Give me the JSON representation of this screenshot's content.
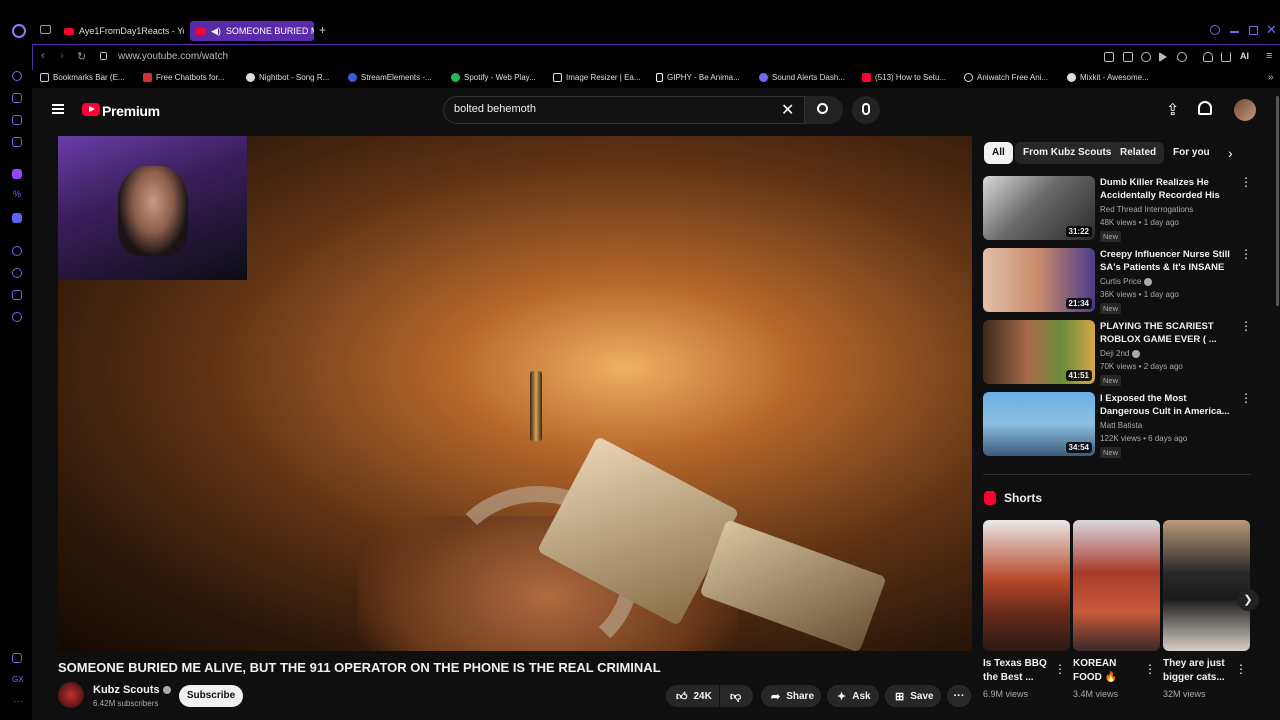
{
  "browser": {
    "tabs": [
      {
        "label": "Aye1FromDay1Reacts - Yo"
      },
      {
        "label": "SOMEONE BURIED ME"
      }
    ],
    "new_tab_glyph": "+",
    "url": "www.youtube.com/watch",
    "ai_label": "AI",
    "bookmarks": [
      {
        "label": "Bookmarks Bar (E...",
        "icon": "folder-icon",
        "color": "#cccccc"
      },
      {
        "label": "Free Chatbots for...",
        "icon": "chatbot-icon",
        "color": "#d83030"
      },
      {
        "label": "Nightbot - Song R...",
        "icon": "nightbot-icon",
        "color": "#dddddd"
      },
      {
        "label": "StreamElements -...",
        "icon": "streamelements-icon",
        "color": "#3a5bd8"
      },
      {
        "label": "Spotify - Web Play...",
        "icon": "spotify-icon",
        "color": "#1db954"
      },
      {
        "label": "Image Resizer | Ea...",
        "icon": "image-icon",
        "color": "#dddddd"
      },
      {
        "label": "GIPHY - Be Anima...",
        "icon": "giphy-icon",
        "color": "#ffffff"
      },
      {
        "label": "Sound Alerts Dash...",
        "icon": "soundalerts-icon",
        "color": "#6a6af0"
      },
      {
        "label": "(513) How to Setu...",
        "icon": "youtube-icon",
        "color": "#ff0033"
      },
      {
        "label": "Aniwatch Free Ani...",
        "icon": "aniwatch-icon",
        "color": "#dddddd"
      },
      {
        "label": "Mixkit - Awesome...",
        "icon": "mixkit-icon",
        "color": "#dddddd"
      }
    ]
  },
  "youtube": {
    "logo_text": "Premium",
    "search": {
      "value": "bolted behemoth"
    },
    "video": {
      "title": "SOMEONE BURIED ME ALIVE, BUT THE 911 OPERATOR ON THE PHONE IS THE REAL CRIMINAL",
      "channel": "Kubz Scouts",
      "subscribers": "6.42M subscribers",
      "subscribe_label": "Subscribe",
      "likes": "24K",
      "share_label": "Share",
      "ask_label": "Ask",
      "save_label": "Save"
    },
    "chips": [
      "All",
      "From Kubz Scouts",
      "Related",
      "For you"
    ],
    "recommendations": [
      {
        "title": "Dumb Killer Realizes He Accidentally Recorded His Ow...",
        "channel": "Red Thread Interrogations",
        "meta": "48K views • 1 day ago",
        "badge": "New",
        "duration": "31:22"
      },
      {
        "title": "Creepy Influencer Nurse Still SA's Patients & It's INSANE",
        "channel": "Curtis Price",
        "meta": "36K views • 1 day ago",
        "badge": "New",
        "duration": "21:34"
      },
      {
        "title": "PLAYING THE SCARIEST ROBLOX GAME EVER ( ...",
        "channel": "Deji 2nd",
        "meta": "70K views • 2 days ago",
        "badge": "New",
        "duration": "41:51"
      },
      {
        "title": "I Exposed the Most Dangerous Cult in America...",
        "channel": "Matt Batista",
        "meta": "122K views • 6 days ago",
        "badge": "New",
        "duration": "34:54"
      }
    ],
    "shorts_heading": "Shorts",
    "shorts": [
      {
        "title": "Is Texas BBQ the Best ...",
        "views": "6.9M views"
      },
      {
        "title": "KOREAN FOOD 🔥",
        "views": "3.4M views"
      },
      {
        "title": "They are just bigger cats...",
        "views": "32M views"
      }
    ]
  },
  "colors": {
    "brand": "#ff0033",
    "opera_accent": "#5b2aa8",
    "background": "#0f0f0f"
  }
}
